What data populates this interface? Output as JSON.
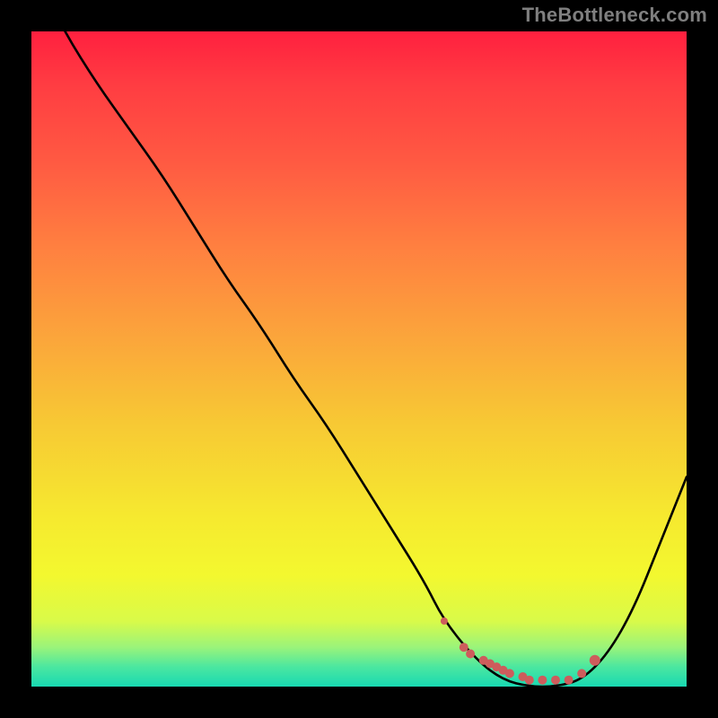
{
  "watermark": "TheBottleneck.com",
  "colors": {
    "page_bg": "#000000",
    "watermark": "#7f7f7f",
    "curve": "#000000",
    "markers": "#cd5c5c",
    "gradient_top": "#ff203f",
    "gradient_bottom": "#18d9b2"
  },
  "chart_data": {
    "type": "line",
    "title": "",
    "xlabel": "",
    "ylabel": "",
    "xlim": [
      0,
      100
    ],
    "ylim": [
      0,
      100
    ],
    "grid": false,
    "legend": false,
    "series": [
      {
        "name": "bottleneck_curve",
        "x": [
          0,
          5,
          10,
          15,
          20,
          25,
          30,
          35,
          40,
          45,
          50,
          55,
          60,
          63,
          68,
          72,
          76,
          80,
          84,
          88,
          92,
          96,
          100
        ],
        "y": [
          110,
          100,
          92,
          85,
          78,
          70,
          62,
          55,
          47,
          40,
          32,
          24,
          16,
          10,
          4,
          1,
          0,
          0,
          1,
          5,
          12,
          22,
          32
        ]
      }
    ],
    "markers": {
      "name": "optimal_zone",
      "x": [
        63,
        66,
        67,
        69,
        70,
        71,
        72,
        73,
        75,
        76,
        78,
        80,
        82,
        84,
        86
      ],
      "y": [
        10,
        6,
        5,
        4,
        3.5,
        3,
        2.5,
        2,
        1.5,
        1,
        1,
        1,
        1,
        2,
        4
      ],
      "size": [
        4,
        5,
        5,
        5,
        5,
        5,
        5,
        5,
        5,
        5,
        5,
        5,
        5,
        5,
        6
      ]
    }
  }
}
